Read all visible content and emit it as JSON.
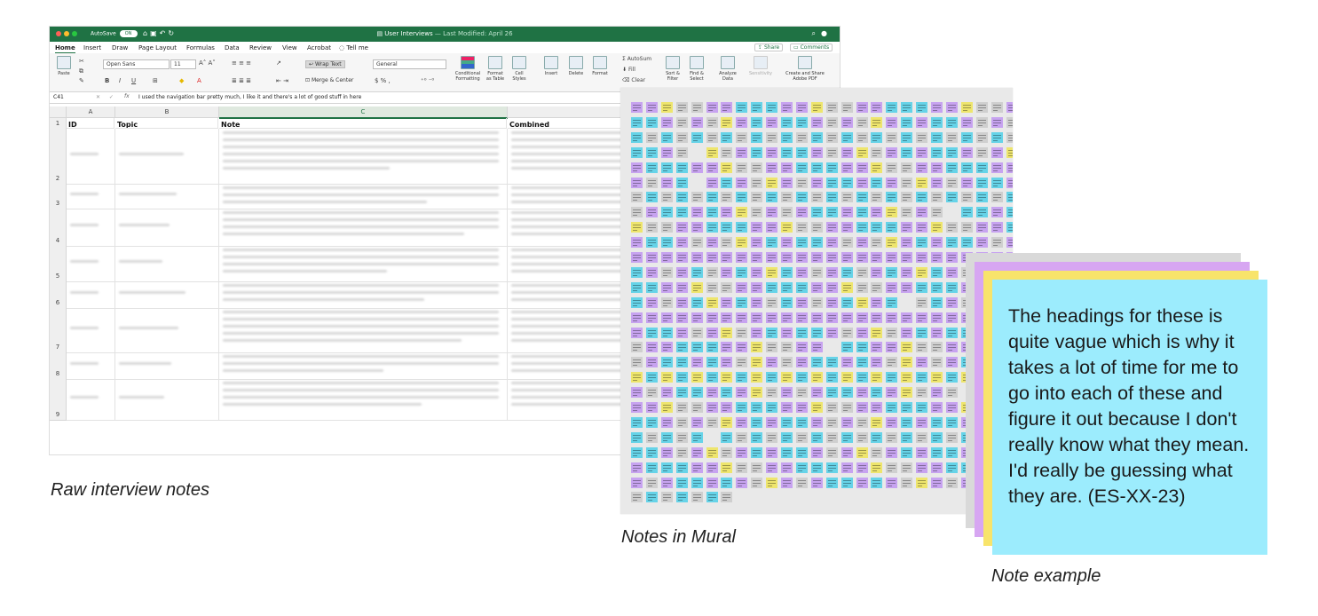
{
  "excel": {
    "autosave_label": "AutoSave",
    "autosave_state": "ON",
    "title": "User Interviews",
    "last_modified": "— Last Modified: April 26",
    "menu_tabs": [
      "Home",
      "Insert",
      "Draw",
      "Page Layout",
      "Formulas",
      "Data",
      "Review",
      "View",
      "Acrobat"
    ],
    "tell_me": "Tell me",
    "share_label": "Share",
    "comments_label": "Comments",
    "ribbon": {
      "paste": "Paste",
      "font_name": "Open Sans",
      "font_size": "11",
      "wrap_text": "Wrap Text",
      "merge_center": "Merge & Center",
      "number_format": "General",
      "conditional_formatting": "Conditional Formatting",
      "format_as_table": "Format as Table",
      "cell_styles": "Cell Styles",
      "insert": "Insert",
      "delete": "Delete",
      "format": "Format",
      "autosum": "AutoSum",
      "fill": "Fill",
      "clear": "Clear",
      "sort_filter": "Sort & Filter",
      "find_select": "Find & Select",
      "analyze_data": "Analyze Data",
      "sensitivity": "Sensitivity",
      "create_share_pdf": "Create and Share Adobe PDF"
    },
    "name_box": "C41",
    "fx_label": "fx",
    "formula_value": "I used the navigation bar pretty much, I like it and there's a lot of good stuff in here",
    "columns": [
      "A",
      "B",
      "C"
    ],
    "headers": {
      "a": "ID",
      "b": "Topic",
      "c": "Note",
      "d": "Combined"
    },
    "row_numbers": [
      "1",
      "2",
      "3",
      "4",
      "5",
      "6",
      "7",
      "8",
      "9"
    ]
  },
  "mural": {
    "colors": {
      "purple": "#c7a3f0",
      "cyan": "#66d3e8",
      "gray": "#cfcfcf",
      "yellow": "#eee56d"
    }
  },
  "note": {
    "text": "The headings for these is quite vague which is why it takes a lot of time for me to go into each of these and figure it out because I don't really know what they mean. I'd really be guessing what they are. (ES-XX-23)",
    "colors": {
      "front": "#9cecfd",
      "yellow": "#f8e46b",
      "purple": "#d7a6f2",
      "gray": "#d9d9d9"
    }
  },
  "captions": {
    "raw": "Raw interview notes",
    "mural": "Notes in Mural",
    "example": "Note example"
  }
}
